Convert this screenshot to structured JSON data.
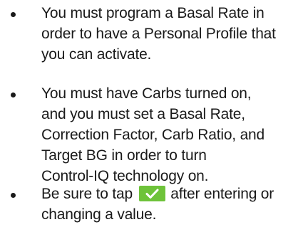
{
  "bullets": [
    {
      "text": "You must program a Basal Rate in\norder to have a Personal Profile that\nyou can activate."
    },
    {
      "text": "You must have Carbs turned on,\nand you must set a Basal Rate,\nCorrection Factor, Carb Ratio, and\nTarget BG in order to turn\nControl-IQ technology on."
    },
    {
      "text_before_icon": "Be sure to tap ",
      "icon": "checkmark-save-icon",
      "text_after_icon": " after entering or\nchanging a value."
    }
  ],
  "colors": {
    "text": "#1a1a1a",
    "checkmark_button": "#6ec33a"
  }
}
